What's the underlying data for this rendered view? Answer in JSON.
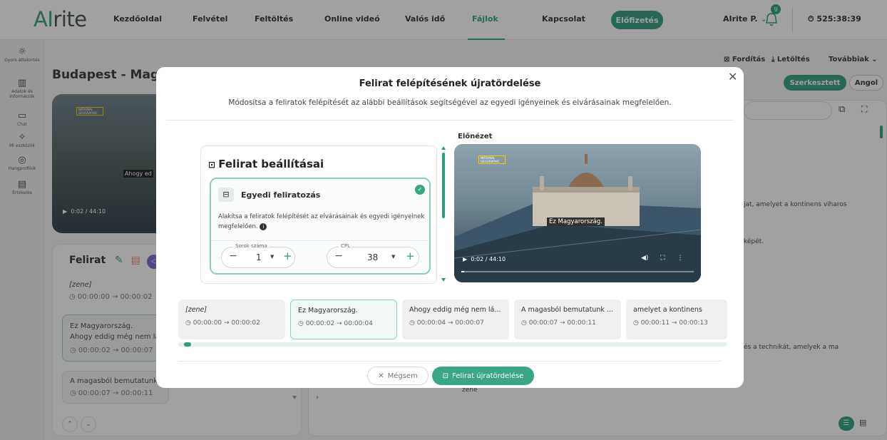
{
  "app": {
    "logo_ai": "AI",
    "logo_rest": "rite"
  },
  "nav": {
    "items": [
      "Kezdőoldal",
      "Felvétel",
      "Feltöltés",
      "Online videó",
      "Valós idő",
      "Fájlok",
      "Kapcsolat"
    ],
    "active": "Fájlok",
    "subscribe": "Előfizetés",
    "user": "AIrite P.",
    "notification_count": "9",
    "timer": "525:38:39"
  },
  "sidebar": {
    "items": [
      {
        "label": "Gyors áttekintés",
        "icon": "bulb-icon"
      },
      {
        "label": "Adatok és információk",
        "icon": "bar-chart-icon"
      },
      {
        "label": "Chat",
        "icon": "chat-icon"
      },
      {
        "label": "MI eszközök",
        "icon": "sparkle-icon"
      },
      {
        "label": "Hangprofilok",
        "icon": "voice-icon"
      },
      {
        "label": "Értékelés",
        "icon": "rating-icon"
      }
    ]
  },
  "background": {
    "page_title": "Budapest - Magy",
    "video_time": "0:02 / 44:10",
    "video_caption": "Ahogy ed",
    "subtitle_panel_title": "Felirat",
    "cards": [
      {
        "text": "[zene]",
        "time": "00:00:00 → 00:00:02"
      },
      {
        "text": "Ez Magyarország.\nAhogy eddig még nem lá",
        "time": "00:00:02 → 00:00:07"
      },
      {
        "text": "A magasból bemutatunk",
        "time": "00:00:07 → 00:00:11"
      }
    ],
    "right_actions": {
      "translate": "Fordítás",
      "download": "Letöltés",
      "more": "Továbbiak"
    },
    "edited_badge": "Szerkesztett",
    "language_badge": "Angol",
    "transcript_lines": [
      "jat, amelyet a kontinens viharos",
      "képét.",
      "és a technikát, amelyek a ma",
      "zene"
    ]
  },
  "modal": {
    "title": "Felirat felépítésének újratördelése",
    "subtitle": "Módosítsa a feliratok felépítését az alábbi beállítások segítségével az egyedi igényeinek és elvárásainak megfelelően.",
    "settings_title": "Felirat beállításai",
    "custom": {
      "title": "Egyedi feliratozás",
      "description": "Alakítsa a feliratok felépítését az elvárásainak és egyedi igényeinek megfelelően."
    },
    "rows": {
      "label": "Sorok száma",
      "value": "1"
    },
    "cpl": {
      "label": "CPL",
      "value": "38"
    },
    "preview_label": "Előnézet",
    "preview_caption": "Ez Magyarország.",
    "preview_time": "0:02 / 44:10",
    "natgeo_logo": "NATIONAL GEOGRAPHIC",
    "segments": [
      {
        "text": "[zene]",
        "time": "00:00:00 → 00:00:02"
      },
      {
        "text": "Ez Magyarország.",
        "time": "00:00:02 → 00:00:04"
      },
      {
        "text": "Ahogy eddig még nem lá...",
        "time": "00:00:04 → 00:00:07"
      },
      {
        "text": "A magasból bemutatunk ...",
        "time": "00:00:07 → 00:00:11"
      },
      {
        "text": "amelyet a kontinens",
        "time": "00:00:11 → 00:00:13"
      }
    ],
    "cancel": "Mégsem",
    "confirm": "Felirat újratördelése"
  },
  "colors": {
    "accent": "#2e9c7f",
    "overlay": "rgba(30,30,30,0.42)"
  }
}
